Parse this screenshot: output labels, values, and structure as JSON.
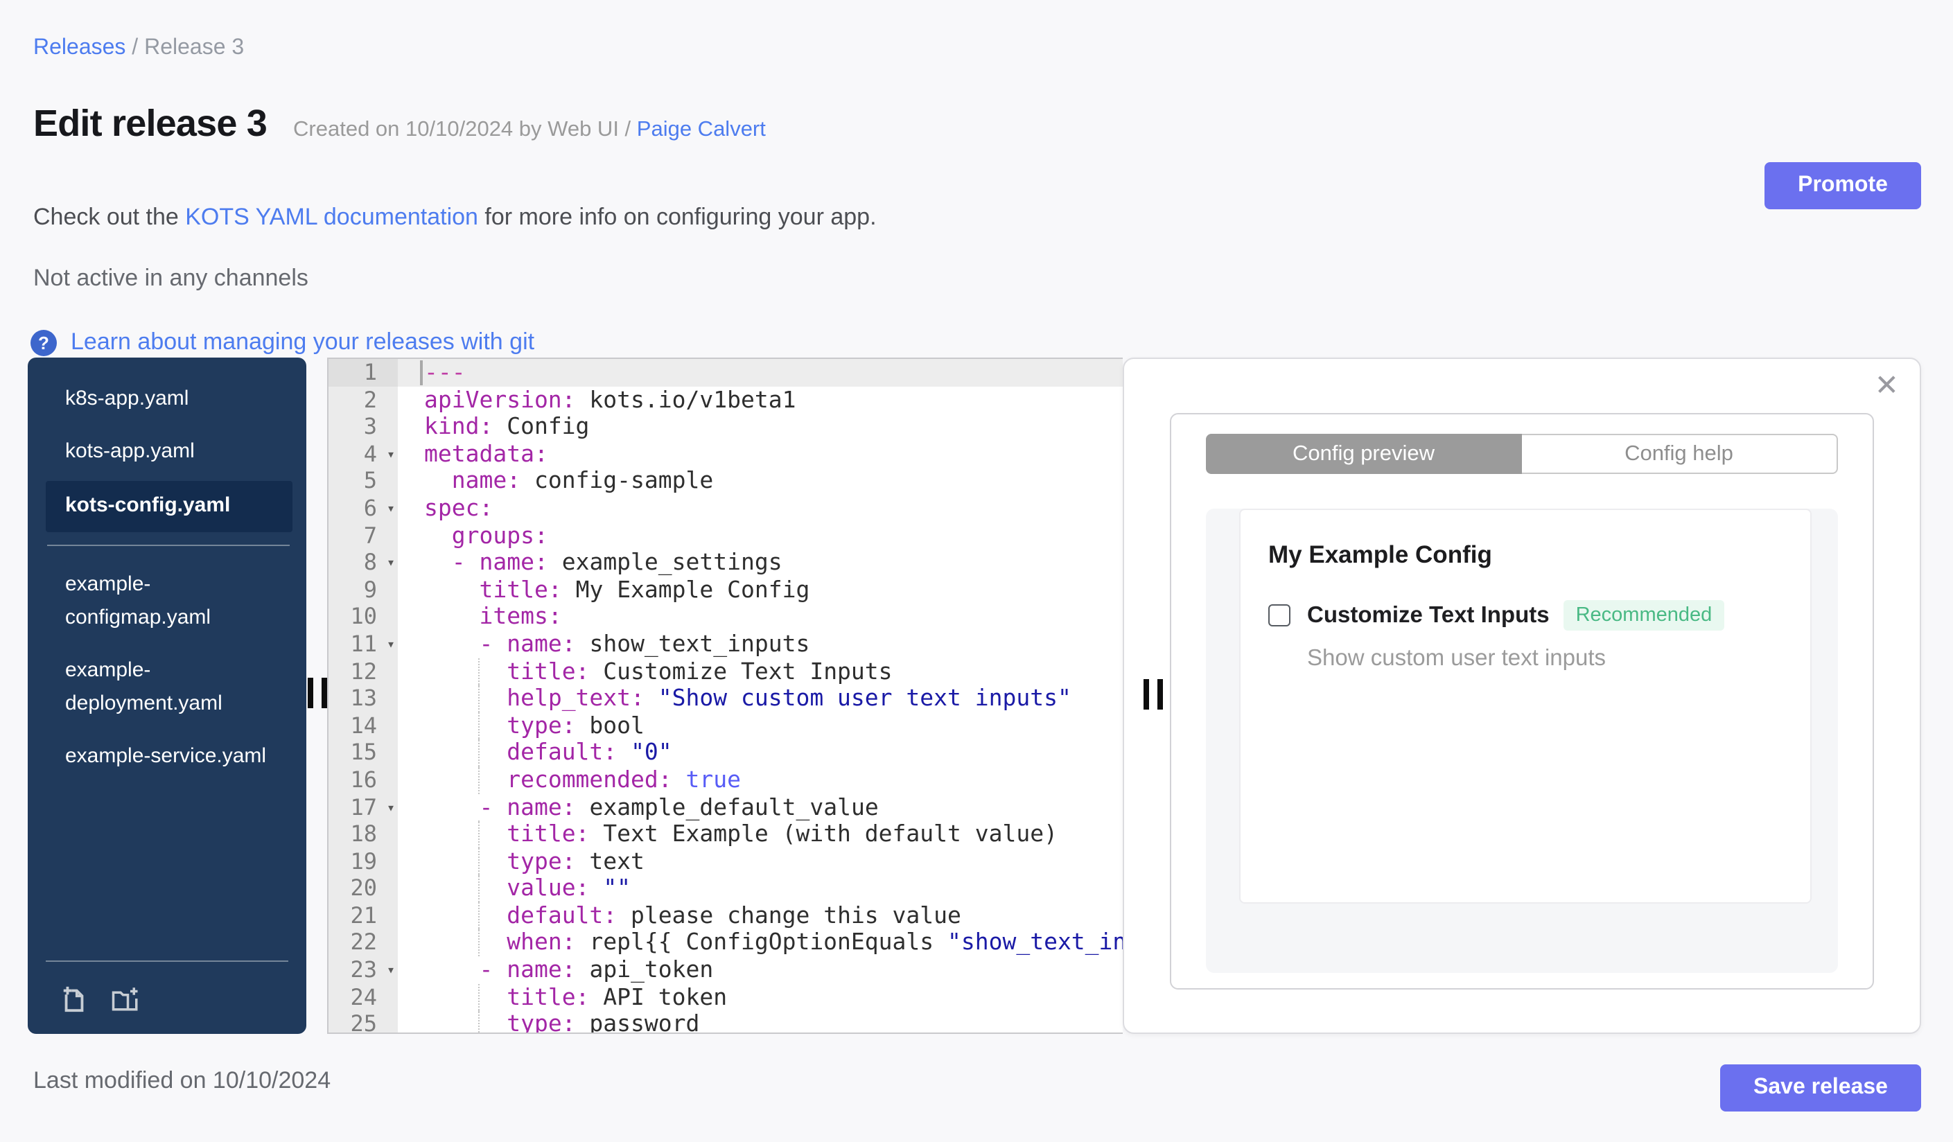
{
  "breadcrumb": {
    "link": "Releases",
    "separator": " / ",
    "current": "Release 3"
  },
  "header": {
    "title": "Edit release 3",
    "created_prefix": "Created on 10/10/2024 by Web UI / ",
    "created_link": "Paige Calvert",
    "doc_prefix": "Check out the ",
    "doc_link": "KOTS YAML documentation",
    "doc_suffix": " for more info on configuring your app.",
    "channel_status": "Not active in any channels",
    "learn_icon": "?",
    "learn_link": "Learn about managing your releases with git",
    "promote_label": "Promote"
  },
  "sidebar": {
    "files": [
      {
        "name": "k8s-app.yaml",
        "selected": false,
        "divider_after": false
      },
      {
        "name": "kots-app.yaml",
        "selected": false,
        "divider_after": false
      },
      {
        "name": "kots-config.yaml",
        "selected": true,
        "divider_after": true
      },
      {
        "name": "example-configmap.yaml",
        "selected": false,
        "divider_after": false
      },
      {
        "name": "example-deployment.yaml",
        "selected": false,
        "divider_after": false
      },
      {
        "name": "example-service.yaml",
        "selected": false,
        "divider_after": false
      }
    ],
    "footer_icons": [
      "add-file-icon",
      "add-folder-icon"
    ]
  },
  "editor": {
    "active_line": 1,
    "fold_glyph": "▾",
    "lines": [
      {
        "n": 1,
        "fold": false,
        "guide": false,
        "tokens": [
          [
            "doc",
            "---"
          ]
        ]
      },
      {
        "n": 2,
        "fold": false,
        "guide": false,
        "tokens": [
          [
            "key",
            "apiVersion:"
          ],
          [
            "plain",
            " kots.io/v1beta1"
          ]
        ]
      },
      {
        "n": 3,
        "fold": false,
        "guide": false,
        "tokens": [
          [
            "key",
            "kind:"
          ],
          [
            "plain",
            " Config"
          ]
        ]
      },
      {
        "n": 4,
        "fold": true,
        "guide": false,
        "tokens": [
          [
            "key",
            "metadata:"
          ]
        ]
      },
      {
        "n": 5,
        "fold": false,
        "guide": false,
        "tokens": [
          [
            "plain",
            "  "
          ],
          [
            "key",
            "name:"
          ],
          [
            "plain",
            " config-sample"
          ]
        ]
      },
      {
        "n": 6,
        "fold": true,
        "guide": false,
        "tokens": [
          [
            "key",
            "spec:"
          ]
        ]
      },
      {
        "n": 7,
        "fold": false,
        "guide": false,
        "tokens": [
          [
            "plain",
            "  "
          ],
          [
            "key",
            "groups:"
          ]
        ]
      },
      {
        "n": 8,
        "fold": true,
        "guide": false,
        "tokens": [
          [
            "plain",
            "  "
          ],
          [
            "key",
            "- name:"
          ],
          [
            "plain",
            " example_settings"
          ]
        ]
      },
      {
        "n": 9,
        "fold": false,
        "guide": false,
        "tokens": [
          [
            "plain",
            "    "
          ],
          [
            "key",
            "title:"
          ],
          [
            "plain",
            " My Example Config"
          ]
        ]
      },
      {
        "n": 10,
        "fold": false,
        "guide": false,
        "tokens": [
          [
            "plain",
            "    "
          ],
          [
            "key",
            "items:"
          ]
        ]
      },
      {
        "n": 11,
        "fold": true,
        "guide": false,
        "tokens": [
          [
            "plain",
            "    "
          ],
          [
            "key",
            "- name:"
          ],
          [
            "plain",
            " show_text_inputs"
          ]
        ]
      },
      {
        "n": 12,
        "fold": false,
        "guide": true,
        "tokens": [
          [
            "plain",
            "      "
          ],
          [
            "key",
            "title:"
          ],
          [
            "plain",
            " Customize Text Inputs"
          ]
        ]
      },
      {
        "n": 13,
        "fold": false,
        "guide": true,
        "tokens": [
          [
            "plain",
            "      "
          ],
          [
            "key",
            "help_text:"
          ],
          [
            "plain",
            " "
          ],
          [
            "str",
            "\"Show custom user text inputs\""
          ]
        ]
      },
      {
        "n": 14,
        "fold": false,
        "guide": true,
        "tokens": [
          [
            "plain",
            "      "
          ],
          [
            "key",
            "type:"
          ],
          [
            "plain",
            " bool"
          ]
        ]
      },
      {
        "n": 15,
        "fold": false,
        "guide": true,
        "tokens": [
          [
            "plain",
            "      "
          ],
          [
            "key",
            "default:"
          ],
          [
            "plain",
            " "
          ],
          [
            "str",
            "\"0\""
          ]
        ]
      },
      {
        "n": 16,
        "fold": false,
        "guide": true,
        "tokens": [
          [
            "plain",
            "      "
          ],
          [
            "key",
            "recommended:"
          ],
          [
            "plain",
            " "
          ],
          [
            "const",
            "true"
          ]
        ]
      },
      {
        "n": 17,
        "fold": true,
        "guide": false,
        "tokens": [
          [
            "plain",
            "    "
          ],
          [
            "key",
            "- name:"
          ],
          [
            "plain",
            " example_default_value"
          ]
        ]
      },
      {
        "n": 18,
        "fold": false,
        "guide": true,
        "tokens": [
          [
            "plain",
            "      "
          ],
          [
            "key",
            "title:"
          ],
          [
            "plain",
            " Text Example (with default value)"
          ]
        ]
      },
      {
        "n": 19,
        "fold": false,
        "guide": true,
        "tokens": [
          [
            "plain",
            "      "
          ],
          [
            "key",
            "type:"
          ],
          [
            "plain",
            " text"
          ]
        ]
      },
      {
        "n": 20,
        "fold": false,
        "guide": true,
        "tokens": [
          [
            "plain",
            "      "
          ],
          [
            "key",
            "value:"
          ],
          [
            "plain",
            " "
          ],
          [
            "str",
            "\"\""
          ]
        ]
      },
      {
        "n": 21,
        "fold": false,
        "guide": true,
        "tokens": [
          [
            "plain",
            "      "
          ],
          [
            "key",
            "default:"
          ],
          [
            "plain",
            " please change this value"
          ]
        ]
      },
      {
        "n": 22,
        "fold": false,
        "guide": true,
        "tokens": [
          [
            "plain",
            "      "
          ],
          [
            "key",
            "when:"
          ],
          [
            "plain",
            " repl{{ ConfigOptionEquals "
          ],
          [
            "str",
            "\"show_text_inputs\""
          ]
        ]
      },
      {
        "n": 23,
        "fold": true,
        "guide": false,
        "tokens": [
          [
            "plain",
            "    "
          ],
          [
            "key",
            "- name:"
          ],
          [
            "plain",
            " api_token"
          ]
        ]
      },
      {
        "n": 24,
        "fold": false,
        "guide": true,
        "tokens": [
          [
            "plain",
            "      "
          ],
          [
            "key",
            "title:"
          ],
          [
            "plain",
            " API token"
          ]
        ]
      },
      {
        "n": 25,
        "fold": false,
        "guide": true,
        "tokens": [
          [
            "plain",
            "      "
          ],
          [
            "key",
            "type:"
          ],
          [
            "plain",
            " password"
          ]
        ]
      }
    ]
  },
  "preview": {
    "close_glyph": "✕",
    "tabs": [
      {
        "label": "Config preview",
        "active": true
      },
      {
        "label": "Config help",
        "active": false
      }
    ],
    "group_title": "My Example Config",
    "item": {
      "label": "Customize Text Inputs",
      "checked": false,
      "badge": "Recommended",
      "help": "Show custom user text inputs"
    }
  },
  "footer": {
    "last_modified": "Last modified on 10/10/2024",
    "save_label": "Save release"
  },
  "colors": {
    "link_blue": "#4d7cef",
    "button_purple": "#6b70ef",
    "sidebar_navy": "#203a5c",
    "sidebar_selected": "#132c4e",
    "badge_green": "#49b984",
    "badge_green_bg": "#e9f8f0",
    "yaml_key": "#a326a6",
    "yaml_string": "#1a1aa6",
    "yaml_constant": "#585cf6",
    "yaml_doc_separator": "#bf3fa6"
  }
}
